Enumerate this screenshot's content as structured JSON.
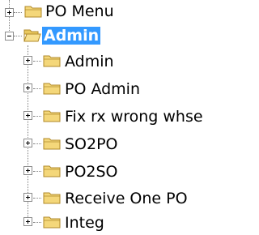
{
  "tree": {
    "top_item": {
      "label": "PO Menu",
      "expanded": false
    },
    "admin_root": {
      "label": "Admin",
      "expanded": true,
      "selected": true
    },
    "children": [
      {
        "label": "Admin",
        "expanded": false
      },
      {
        "label": "PO Admin",
        "expanded": false
      },
      {
        "label": "Fix rx wrong whse",
        "expanded": false
      },
      {
        "label": "SO2PO",
        "expanded": false
      },
      {
        "label": "PO2SO",
        "expanded": false
      },
      {
        "label": "Receive One PO",
        "expanded": false
      },
      {
        "label": "Integ",
        "expanded": false
      }
    ]
  },
  "colors": {
    "selection": "#3399ff",
    "folder_fill": "#f4d77a",
    "folder_outline": "#b08a2a",
    "connector": "#808080"
  }
}
